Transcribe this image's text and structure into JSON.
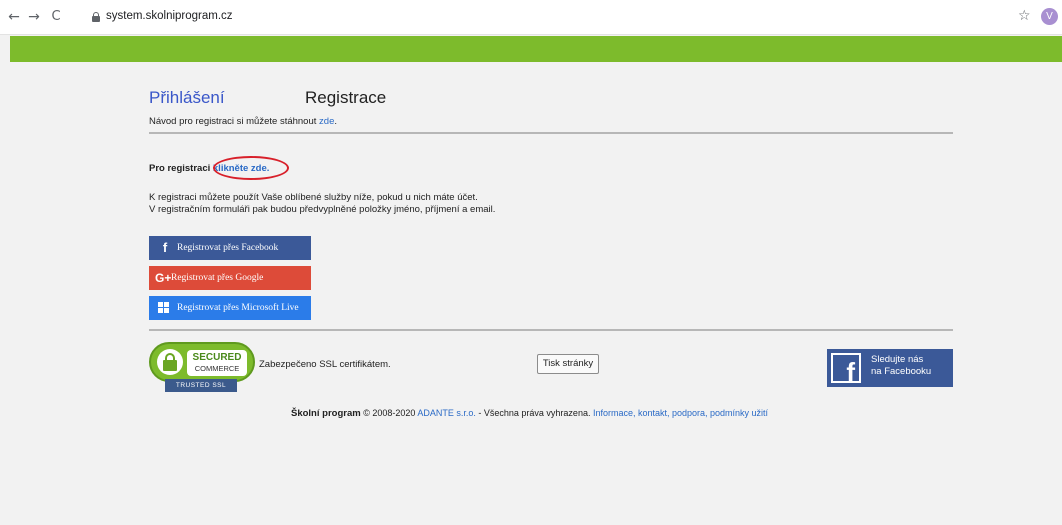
{
  "browser": {
    "url": "system.skolniprogram.cz",
    "avatar_letter": "V",
    "back_glyph": "←",
    "forward_glyph": "→",
    "reload_glyph": "C",
    "star_glyph": "☆"
  },
  "tabs": {
    "login": "Přihlášení",
    "register": "Registrace"
  },
  "guide": {
    "text": "Návod pro registraci si můžete stáhnout ",
    "link": "zde",
    "suffix": "."
  },
  "registration": {
    "prefix": "Pro registraci ",
    "link": "klikněte zde."
  },
  "info": {
    "line1": "K registraci můžete použít Vaše oblíbené služby níže, pokud u nich máte účet.",
    "line2": "V registračním formuláři pak budou předvyplněné položky jméno, příjmení a email."
  },
  "social_buttons": {
    "facebook": "Registrovat přes Facebook",
    "google": "Registrovat přes Google",
    "google_icon": "G+",
    "microsoft": "Registrovat přes Microsoft Live",
    "facebook_icon": "f"
  },
  "ssl": {
    "badge_line1": "SECURED",
    "badge_line2": "COMMERCE",
    "badge_trusted": "TRUSTED SSL",
    "caption": "Zabezpečeno SSL certifikátem."
  },
  "print_button": "Tisk stránky",
  "facebook_follow": {
    "icon": "f",
    "line1": "Sledujte nás",
    "line2": "na Facebooku"
  },
  "footer": {
    "brand": "Školní program",
    "copyright": " © 2008-2020 ",
    "company": "ADANTE s.r.o.",
    "rights": " - Všechna práva vyhrazena. ",
    "links": "Informace, kontakt, podpora, podmínky užití"
  },
  "colors": {
    "accent_green": "#7dbb2c",
    "facebook": "#3b5998",
    "google": "#dd4b39",
    "microsoft": "#2b7ce9",
    "link": "#2a6ac6",
    "annotation_red": "#d8202a"
  }
}
